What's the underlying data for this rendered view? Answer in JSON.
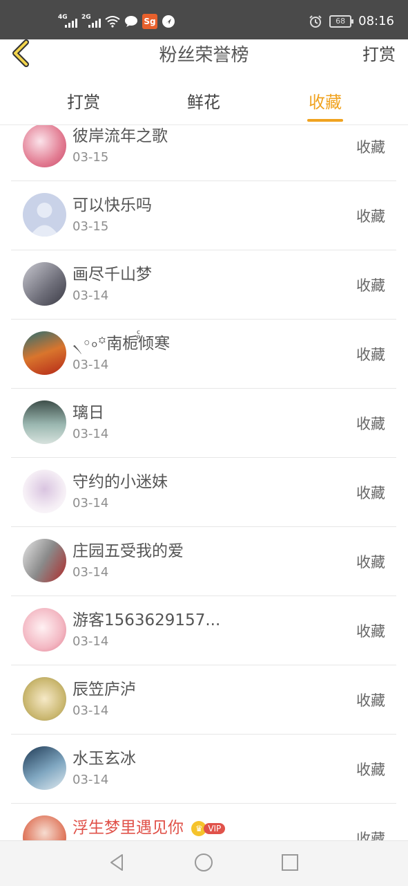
{
  "status_bar": {
    "net1": "4G",
    "net2": "2G",
    "app_badge": "Sg",
    "battery": "68",
    "time": "08:16"
  },
  "header": {
    "title": "粉丝荣誉榜",
    "right_action": "打赏"
  },
  "tabs": [
    {
      "label": "打赏"
    },
    {
      "label": "鲜花"
    },
    {
      "label": "收藏"
    }
  ],
  "active_tab": "收藏",
  "list": [
    {
      "name": "彼岸流年之歌",
      "date": "03-15",
      "action": "收藏",
      "avatar_color": "#e8a5b5"
    },
    {
      "name": "可以快乐吗",
      "date": "03-15",
      "action": "收藏",
      "avatar_color": "#c9d2e8"
    },
    {
      "name": "画尽千山梦",
      "date": "03-14",
      "action": "收藏",
      "avatar_color": "#8e8e98"
    },
    {
      "name": "৲◦৹꙳南栀ⷴⷭ倾寒",
      "date": "03-14",
      "action": "收藏",
      "avatar_color": "#c25a2a"
    },
    {
      "name": "璃日",
      "date": "03-14",
      "action": "收藏",
      "avatar_color": "#6f8a88"
    },
    {
      "name": "守约的小迷妹",
      "date": "03-14",
      "action": "收藏",
      "avatar_color": "#f1e6ef"
    },
    {
      "name": "庄园五受我的爱",
      "date": "03-14",
      "action": "收藏",
      "avatar_color": "#7a7a7a"
    },
    {
      "name": "游客1563629157...",
      "date": "03-14",
      "action": "收藏",
      "avatar_color": "#f2c2c8"
    },
    {
      "name": "辰笠庐泸",
      "date": "03-14",
      "action": "收藏",
      "avatar_color": "#d9c88a"
    },
    {
      "name": "水玉玄冰",
      "date": "03-14",
      "action": "收藏",
      "avatar_color": "#4e7290"
    },
    {
      "name": "浮生梦里遇见你",
      "date": "",
      "action": "收藏",
      "avatar_color": "#e07a60",
      "vip": "VIP"
    }
  ]
}
